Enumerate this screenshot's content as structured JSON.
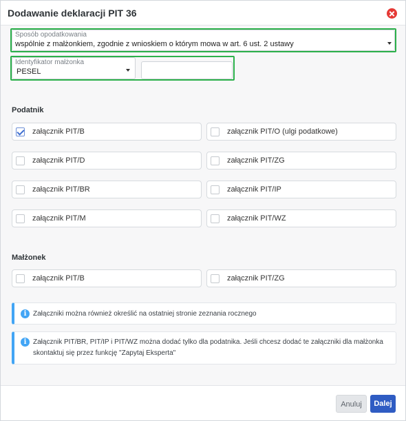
{
  "dialog": {
    "title": "Dodawanie deklaracji PIT 36",
    "close_icon": "close-icon"
  },
  "tax_method": {
    "label": "Sposób opodatkowania",
    "value": "wspólnie z małżonkiem, zgodnie z wnioskiem o którym mowa w art. 6 ust. 2 ustawy"
  },
  "spouse_id": {
    "label": "Identyfikator małżonka",
    "type_value": "PESEL",
    "number_value": ""
  },
  "taxpayer": {
    "title": "Podatnik",
    "items": [
      {
        "label": "załącznik PIT/B",
        "checked": true
      },
      {
        "label": "załącznik PIT/O (ulgi podatkowe)",
        "checked": false
      },
      {
        "label": "załącznik PIT/D",
        "checked": false
      },
      {
        "label": "załącznik PIT/ZG",
        "checked": false
      },
      {
        "label": "załącznik PIT/BR",
        "checked": false
      },
      {
        "label": "załącznik PIT/IP",
        "checked": false
      },
      {
        "label": "załącznik PIT/M",
        "checked": false
      },
      {
        "label": "załącznik PIT/WZ",
        "checked": false
      }
    ]
  },
  "spouse": {
    "title": "Małżonek",
    "items": [
      {
        "label": "załącznik PIT/B",
        "checked": false
      },
      {
        "label": "załącznik PIT/ZG",
        "checked": false
      }
    ]
  },
  "info": {
    "note1": "Załączniki można również określić na ostatniej stronie zeznania rocznego",
    "note2_line1": "Załącznik PIT/BR, PIT/IP i PIT/WZ można dodać tylko dla podatnika. Jeśli chcesz dodać te załączniki dla małżonka",
    "note2_line2": "skontaktuj się przez funkcję \"Zapytaj Eksperta\"",
    "icon": "info-icon",
    "icon_glyph": "i",
    "accent": "#42a5f5"
  },
  "footer": {
    "cancel_label": "Anuluj",
    "next_label": "Dalej"
  },
  "colors": {
    "highlight": "#2bb04a",
    "primary": "#2f5cc3",
    "danger": "#e53935"
  }
}
